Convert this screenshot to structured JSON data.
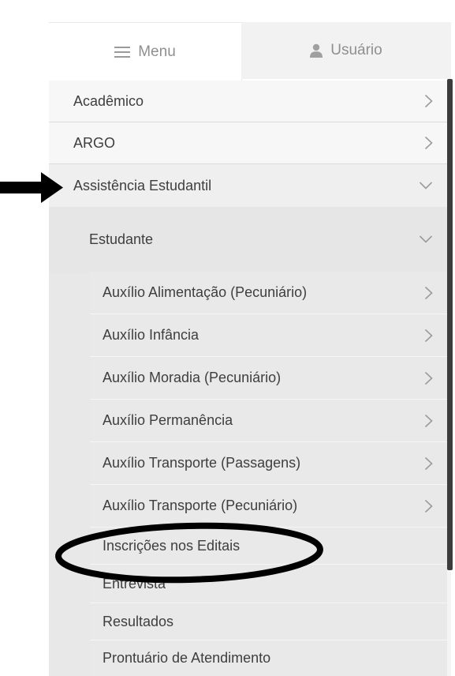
{
  "tabs": {
    "menu": {
      "label": "Menu",
      "icon": "hamburger-icon"
    },
    "user": {
      "label": "Usuário",
      "icon": "user-icon"
    }
  },
  "menu": {
    "top_items": [
      {
        "label": "Acadêmico",
        "icon": "chevron-right-icon"
      },
      {
        "label": "ARGO",
        "icon": "chevron-right-icon"
      },
      {
        "label": "Assistência Estudantil",
        "icon": "chevron-down-icon"
      }
    ],
    "student": {
      "label": "Estudante",
      "icon": "chevron-down-icon"
    },
    "student_items": [
      {
        "label": "Auxílio Alimentação (Pecuniário)",
        "icon": "chevron-right-icon"
      },
      {
        "label": "Auxílio Infância",
        "icon": "chevron-right-icon"
      },
      {
        "label": "Auxílio Moradia (Pecuniário)",
        "icon": "chevron-right-icon"
      },
      {
        "label": "Auxílio Permanência",
        "icon": "chevron-right-icon"
      },
      {
        "label": "Auxílio Transporte (Passagens)",
        "icon": "chevron-right-icon"
      },
      {
        "label": "Auxílio Transporte (Pecuniário)",
        "icon": "chevron-right-icon"
      },
      {
        "label": "Inscrições nos Editais"
      },
      {
        "label": "Entrevista"
      },
      {
        "label": "Resultados"
      },
      {
        "label": "Prontuário de Atendimento"
      }
    ]
  },
  "annotations": {
    "pointer": "arrow-pointer",
    "highlight": "ellipse-highlight"
  }
}
